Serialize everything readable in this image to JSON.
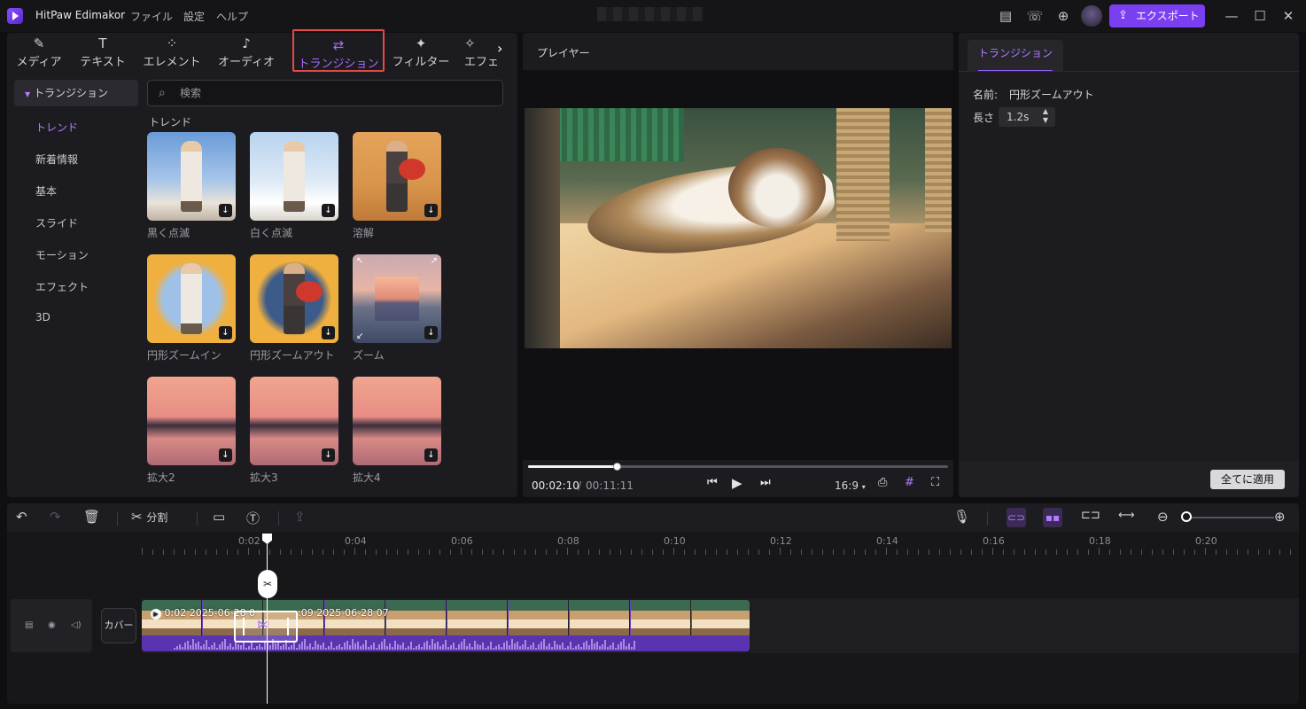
{
  "app": {
    "title": "HitPaw Edimakor",
    "menus": [
      "ファイル",
      "設定",
      "ヘルプ"
    ],
    "export_label": "エクスポート"
  },
  "categories": [
    {
      "label": "メディア",
      "icon": "media-icon"
    },
    {
      "label": "テキスト",
      "icon": "text-icon"
    },
    {
      "label": "エレメント",
      "icon": "element-icon"
    },
    {
      "label": "オーディオ",
      "icon": "audio-icon"
    },
    {
      "label": "トランジション",
      "icon": "transition-icon"
    },
    {
      "label": "フィルター",
      "icon": "filter-icon"
    },
    {
      "label": "エフェ",
      "icon": "effect-icon"
    }
  ],
  "sidebar": {
    "header": "トランジション",
    "items": [
      "トレンド",
      "新着情報",
      "基本",
      "スライド",
      "モーション",
      "エフェクト",
      "3D"
    ]
  },
  "search": {
    "placeholder": "検索"
  },
  "group_title": "トレンド",
  "transitions": [
    {
      "label": "黒く点滅"
    },
    {
      "label": "白く点滅"
    },
    {
      "label": "溶解"
    },
    {
      "label": "円形ズームイン"
    },
    {
      "label": "円形ズームアウト"
    },
    {
      "label": "ズーム"
    },
    {
      "label": "拡大2"
    },
    {
      "label": "拡大3"
    },
    {
      "label": "拡大4"
    }
  ],
  "player": {
    "title": "プレイヤー",
    "current_time": "00:02:10",
    "separator": "/",
    "total_time": "00:11:11",
    "aspect_ratio": "16:9",
    "progress_fraction": 0.21
  },
  "properties": {
    "tab": "トランジション",
    "name_label": "名前:",
    "name_value": "円形ズームアウト",
    "length_label": "長さ",
    "length_value": "1.2s",
    "apply_all": "全てに適用"
  },
  "timeline": {
    "split_label": "分割",
    "ruler": [
      "0:02",
      "0:04",
      "0:06",
      "0:08",
      "0:10",
      "0:12",
      "0:14",
      "0:16",
      "0:18",
      "0:20"
    ],
    "cover_label": "カバー",
    "clip1_info": "0:02 2025-06-28 0",
    "clip2_info": ":09 2025-06-28 07"
  },
  "colors": {
    "accent": "#7b3ff2",
    "highlight_border": "#e24a4a",
    "panel": "#1c1c20"
  }
}
